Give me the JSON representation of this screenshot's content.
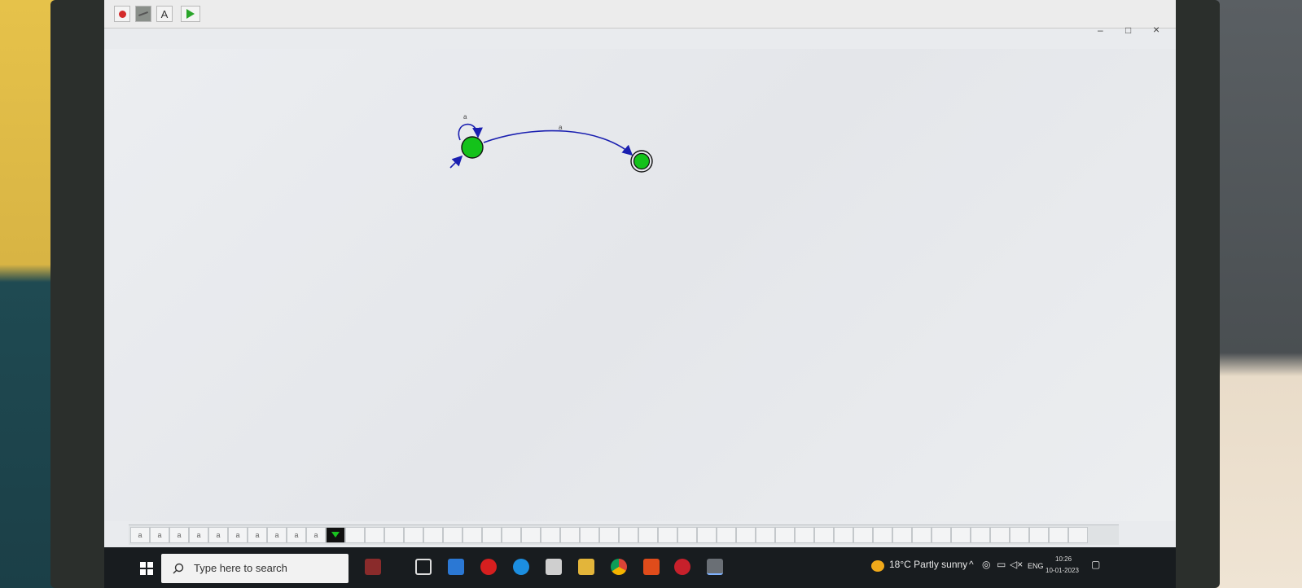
{
  "toolbar": {
    "tools": [
      {
        "icon": "record-dot-icon"
      },
      {
        "icon": "edge-draw-icon"
      },
      {
        "label": "A",
        "icon": "text-tool-icon"
      },
      {
        "icon": "play-run-icon"
      }
    ],
    "window_controls": {
      "minimize": "–",
      "maximize": "□",
      "close": "×"
    }
  },
  "automaton": {
    "states": [
      {
        "id": "q0",
        "initial": true,
        "final": false
      },
      {
        "id": "q1",
        "initial": false,
        "final": true
      }
    ],
    "transitions": [
      {
        "from": "q0",
        "to": "q0",
        "label": "a"
      },
      {
        "from": "q0",
        "to": "q1",
        "label": "a"
      }
    ]
  },
  "tape": {
    "cells": [
      "a",
      "a",
      "a",
      "a",
      "a",
      "a",
      "a",
      "a",
      "a",
      "a",
      "",
      "",
      "",
      "",
      "",
      "",
      "",
      "",
      "",
      "",
      "",
      "",
      "",
      "",
      "",
      "",
      "",
      "",
      "",
      "",
      "",
      "",
      "",
      "",
      "",
      "",
      "",
      "",
      "",
      "",
      "",
      "",
      "",
      "",
      "",
      "",
      "",
      "",
      ""
    ],
    "head_index": 10
  },
  "taskbar": {
    "search_placeholder": "Type here to search",
    "weather": "18°C  Partly sunny",
    "language": "ENG",
    "time": "10:26",
    "date": "10-01-2023"
  },
  "colors": {
    "state_fill": "#14c21a",
    "edge": "#1a1fb0",
    "accent": "#111111"
  }
}
